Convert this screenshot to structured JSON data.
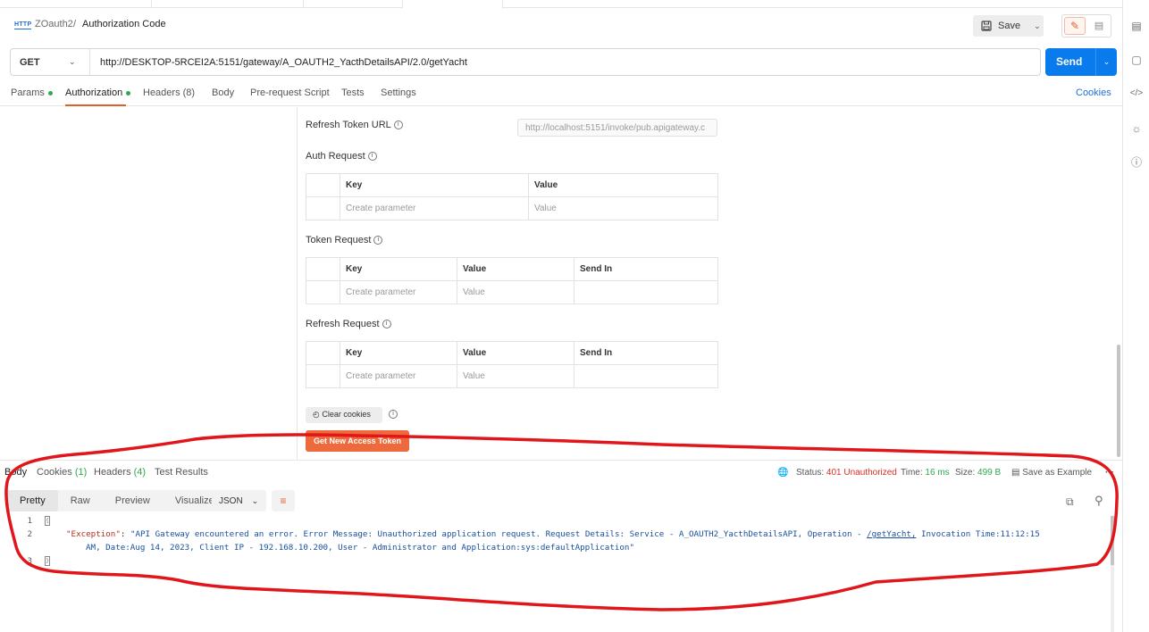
{
  "header": {
    "protocol_badge": "HTTP",
    "breadcrumb_parent": "ZOauth2",
    "breadcrumb_separator": "/",
    "breadcrumb_current": "Authorization Code",
    "save_label": "Save"
  },
  "request": {
    "method": "GET",
    "url": "http://DESKTOP-5RCEI2A:5151/gateway/A_OAUTH2_YacthDetailsAPI/2.0/getYacht",
    "send_label": "Send"
  },
  "request_tabs": {
    "params": "Params",
    "authorization": "Authorization",
    "headers": "Headers (8)",
    "body": "Body",
    "prerequest": "Pre-request Script",
    "tests": "Tests",
    "settings": "Settings",
    "cookies": "Cookies"
  },
  "auth": {
    "refresh_token_url_label": "Refresh Token URL",
    "refresh_token_url_placeholder": "http://localhost:5151/invoke/pub.apigateway.c",
    "auth_request_label": "Auth Request",
    "token_request_label": "Token Request",
    "refresh_request_label": "Refresh Request",
    "col_key": "Key",
    "col_value": "Value",
    "col_send_in": "Send In",
    "ph_key": "Create parameter",
    "ph_value": "Value",
    "clear_cookies": "Clear cookies",
    "get_token": "Get New Access Token"
  },
  "response": {
    "tabs": {
      "body": "Body",
      "cookies": "Cookies",
      "cookies_count": "(1)",
      "headers": "Headers",
      "headers_count": "(4)",
      "test_results": "Test Results"
    },
    "status_label": "Status:",
    "status_value": "401 Unauthorized",
    "time_label": "Time:",
    "time_value": "16 ms",
    "size_label": "Size:",
    "size_value": "499 B",
    "save_example": "Save as Example",
    "views": [
      "Pretty",
      "Raw",
      "Preview",
      "Visualize"
    ],
    "format": "JSON",
    "line_numbers": [
      "1",
      "2",
      "3"
    ],
    "open_brace": "{",
    "close_brace": "}",
    "json_key": "\"Exception\"",
    "json_colon": ": ",
    "json_value_part1": "\"API Gateway encountered an error. Error Message:  Unauthorized application request. Request Details: Service - A_OAUTH2_YacthDetailsAPI, Operation - ",
    "json_value_link": "/getYacht,",
    "json_value_part2": " Invocation Time:11:12:15",
    "json_value_line2": "AM, Date:Aug 14, 2023,  Client IP - 192.168.10.200, User - Administrator and Application:sys:defaultApplication\""
  },
  "colors": {
    "accent_orange": "#e25f2a",
    "send_blue": "#097bed",
    "status_red": "#d93025",
    "ok_green": "#2fa84f",
    "annotation_red": "#e0161b"
  },
  "icons": [
    "http-icon",
    "save-icon",
    "pencil-icon",
    "comment-icon",
    "chevron-down-icon",
    "info-icon",
    "cookie-icon",
    "globe-icon",
    "copy-icon",
    "search-icon",
    "wrap-icon",
    "more-icon",
    "document-icon",
    "code-icon",
    "bulb-icon"
  ]
}
